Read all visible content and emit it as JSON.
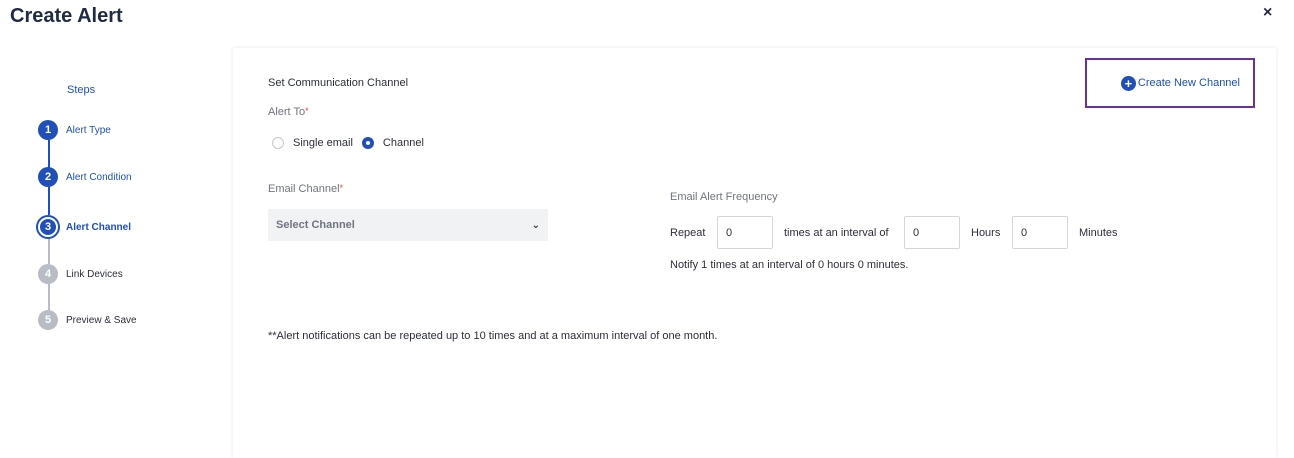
{
  "page": {
    "title": "Create Alert",
    "close_icon": "×"
  },
  "steps": {
    "title": "Steps",
    "items": [
      {
        "number": "1",
        "label": "Alert Type",
        "state": "done"
      },
      {
        "number": "2",
        "label": "Alert Condition",
        "state": "done"
      },
      {
        "number": "3",
        "label": "Alert Channel",
        "state": "active"
      },
      {
        "number": "4",
        "label": "Link Devices",
        "state": "todo"
      },
      {
        "number": "5",
        "label": "Preview & Save",
        "state": "todo"
      }
    ]
  },
  "main": {
    "section_title": "Set Communication Channel",
    "create_channel_icon": "+",
    "create_channel_label": "Create New Channel",
    "alert_to": {
      "label": "Alert To",
      "required_mark": "*",
      "options": [
        {
          "label": "Single email",
          "checked": false
        },
        {
          "label": "Channel",
          "checked": true
        }
      ]
    },
    "email_channel": {
      "label": "Email Channel",
      "required_mark": "*",
      "placeholder": "Select Channel",
      "chevron_icon": "⌄"
    },
    "frequency": {
      "label": "Email Alert Frequency",
      "repeat_label": "Repeat",
      "repeat_value": "0",
      "interval_label": "times at an interval of",
      "hours_value": "0",
      "hours_label": "Hours",
      "minutes_value": "0",
      "minutes_label": "Minutes",
      "summary": "Notify 1 times at an interval of 0 hours 0 minutes."
    },
    "note": "**Alert notifications can be repeated up to 10 times and at a maximum interval of one month."
  },
  "colors": {
    "primary": "#1f4fb7",
    "highlight_border": "#6b2fa0",
    "required": "#e0492f",
    "inactive_step": "#b8bcc4"
  }
}
